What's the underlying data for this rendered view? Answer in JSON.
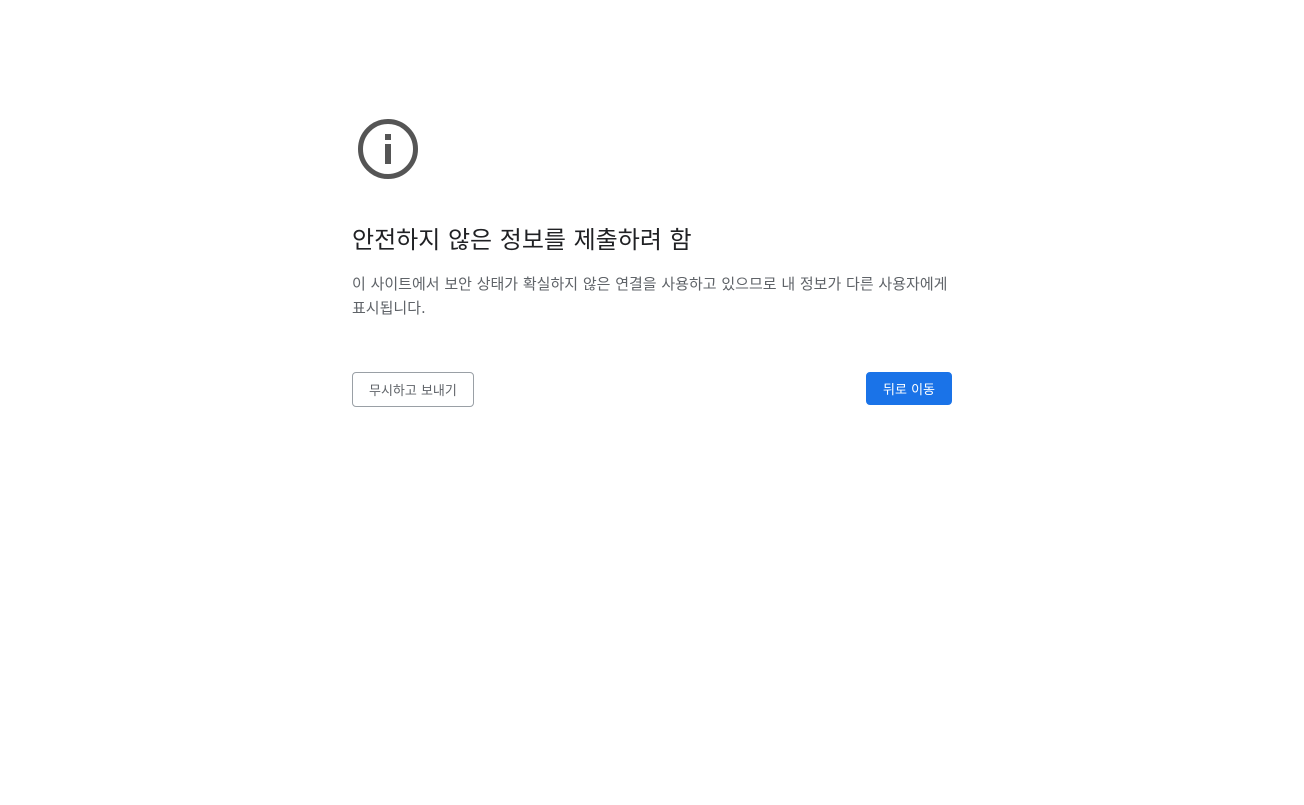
{
  "interstitial": {
    "icon": "info-circle-icon",
    "title": "안전하지 않은 정보를 제출하려 함",
    "message": "이 사이트에서 보안 상태가 확실하지 않은 연결을 사용하고 있으므로 내 정보가 다른 사용자에게 표시됩니다.",
    "buttons": {
      "proceed_label": "무시하고 보내기",
      "back_label": "뒤로 이동"
    }
  },
  "colors": {
    "icon": "#555555",
    "title": "#202124",
    "body_text": "#5f6368",
    "primary_button": "#1a73e8",
    "primary_button_text": "#ffffff",
    "secondary_border": "#9aa0a6"
  }
}
